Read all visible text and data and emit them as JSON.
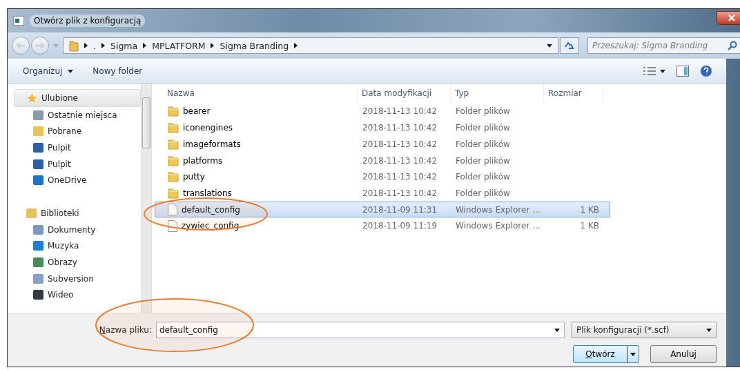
{
  "window": {
    "title": "Otwórz plik z konfiguracją"
  },
  "address_bar": {
    "crumbs": [
      ".",
      "Sigma",
      "MPLATFORM",
      "Sigma Branding"
    ]
  },
  "search": {
    "placeholder": "Przeszukaj: Sigma Branding"
  },
  "toolbar": {
    "organize": "Organizuj",
    "new_folder": "Nowy folder"
  },
  "sidebar": {
    "groups": [
      {
        "label": "Ulubione",
        "selected": true,
        "items": [
          {
            "label": "Ostatnie miejsca"
          },
          {
            "label": "Pobrane"
          },
          {
            "label": "Pulpit"
          },
          {
            "label": "Pulpit"
          },
          {
            "label": "OneDrive"
          }
        ]
      },
      {
        "label": "Biblioteki",
        "selected": false,
        "items": [
          {
            "label": "Dokumenty"
          },
          {
            "label": "Muzyka"
          },
          {
            "label": "Obrazy"
          },
          {
            "label": "Subversion"
          },
          {
            "label": "Wideo"
          }
        ]
      }
    ]
  },
  "table": {
    "columns": [
      "Nazwa",
      "Data modyfikacji",
      "Typ",
      "Rozmiar"
    ],
    "rows": [
      {
        "kind": "folder",
        "name": "bearer",
        "date": "2018-11-13 10:42",
        "type": "Folder plików",
        "selected": false
      },
      {
        "kind": "folder",
        "name": "iconengines",
        "date": "2018-11-13 10:42",
        "type": "Folder plików",
        "selected": false
      },
      {
        "kind": "folder",
        "name": "imageformats",
        "date": "2018-11-13 10:42",
        "type": "Folder plików",
        "selected": false
      },
      {
        "kind": "folder",
        "name": "platforms",
        "date": "2018-11-13 10:42",
        "type": "Folder plików",
        "selected": false
      },
      {
        "kind": "folder",
        "name": "putty",
        "date": "2018-11-13 10:42",
        "type": "Folder plików",
        "selected": false
      },
      {
        "kind": "folder",
        "name": "translations",
        "date": "2018-11-13 10:42",
        "type": "Folder plików",
        "selected": false
      },
      {
        "kind": "file",
        "name": "default_config",
        "date": "2018-11-09 11:31",
        "type": "Windows Explorer ...",
        "size": "1 KB",
        "selected": true
      },
      {
        "kind": "file",
        "name": "zywiec_config",
        "date": "2018-11-09 11:19",
        "type": "Windows Explorer ...",
        "size": "1 KB",
        "selected": false
      }
    ]
  },
  "footer": {
    "filename_label": "Nazwa pliku:",
    "filename": "default_config",
    "filter": "Plik konfiguracji (*.scf)",
    "open": "Otwórz",
    "cancel": "Anuluj"
  }
}
